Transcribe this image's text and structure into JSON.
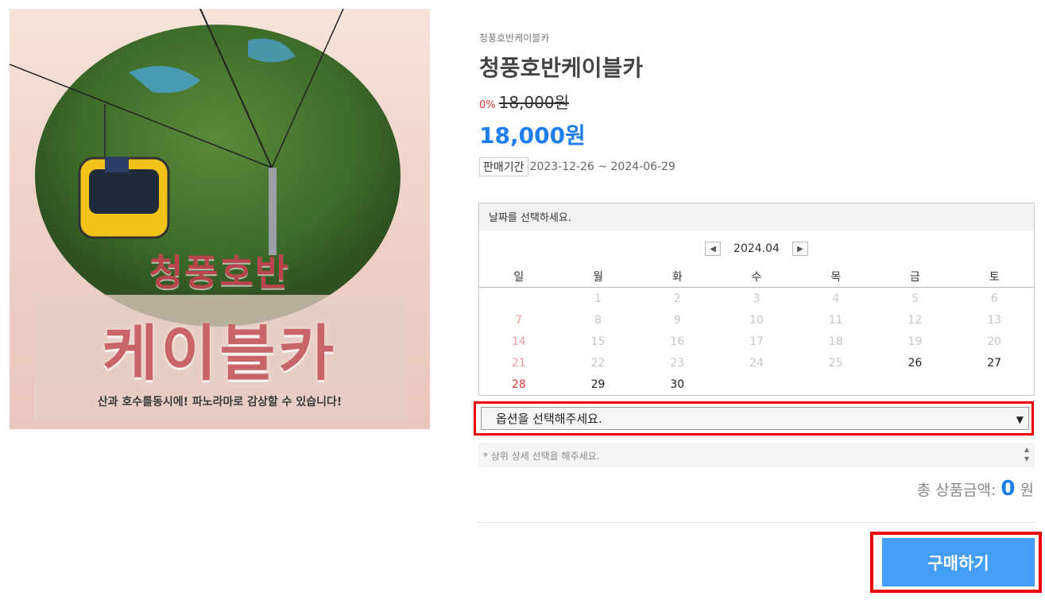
{
  "product_image": {
    "title_line1": "청풍호반",
    "title_line2": "케이블카",
    "caption": "산과 호수를동시에! 파노라마로 감상할 수 있습니다!"
  },
  "product": {
    "brand": "청풍호반케이블카",
    "name": "청풍호반케이블카",
    "discount": "0%",
    "original_price": "18,000원",
    "price": "18,000원",
    "period_label": "판매기간",
    "period_value": "2023-12-26 ~ 2024-06-29"
  },
  "calendar": {
    "prompt": "날짜를 선택하세요.",
    "month": "2024.04",
    "prev_icon": "chevron-left-icon",
    "next_icon": "chevron-right-icon",
    "weekdays": [
      "일",
      "월",
      "화",
      "수",
      "목",
      "금",
      "토"
    ],
    "days": [
      {
        "label": "",
        "state": "empty"
      },
      {
        "label": "1",
        "state": "past"
      },
      {
        "label": "2",
        "state": "past"
      },
      {
        "label": "3",
        "state": "past"
      },
      {
        "label": "4",
        "state": "past"
      },
      {
        "label": "5",
        "state": "past"
      },
      {
        "label": "6",
        "state": "past"
      },
      {
        "label": "7",
        "state": "sun-past"
      },
      {
        "label": "8",
        "state": "past"
      },
      {
        "label": "9",
        "state": "past"
      },
      {
        "label": "10",
        "state": "past"
      },
      {
        "label": "11",
        "state": "past"
      },
      {
        "label": "12",
        "state": "past"
      },
      {
        "label": "13",
        "state": "past"
      },
      {
        "label": "14",
        "state": "sun-past"
      },
      {
        "label": "15",
        "state": "past"
      },
      {
        "label": "16",
        "state": "past"
      },
      {
        "label": "17",
        "state": "past"
      },
      {
        "label": "18",
        "state": "past"
      },
      {
        "label": "19",
        "state": "past"
      },
      {
        "label": "20",
        "state": "past"
      },
      {
        "label": "21",
        "state": "sun-past"
      },
      {
        "label": "22",
        "state": "past"
      },
      {
        "label": "23",
        "state": "past"
      },
      {
        "label": "24",
        "state": "past"
      },
      {
        "label": "25",
        "state": "past"
      },
      {
        "label": "26",
        "state": "avail"
      },
      {
        "label": "27",
        "state": "avail"
      },
      {
        "label": "28",
        "state": "sun-avail"
      },
      {
        "label": "29",
        "state": "avail"
      },
      {
        "label": "30",
        "state": "avail"
      }
    ]
  },
  "option": {
    "placeholder": "옵션을 선택해주세요.",
    "notice": "* 상위 상세 선택을 해주세요."
  },
  "total": {
    "label": "총 상품금액:",
    "amount": "0",
    "unit": "원"
  },
  "buy_label": "구매하기",
  "colors": {
    "accent": "#1e7ef0",
    "buy_button": "#449ef5",
    "highlight_border": "#ee0000",
    "sunday": "#e53935"
  }
}
